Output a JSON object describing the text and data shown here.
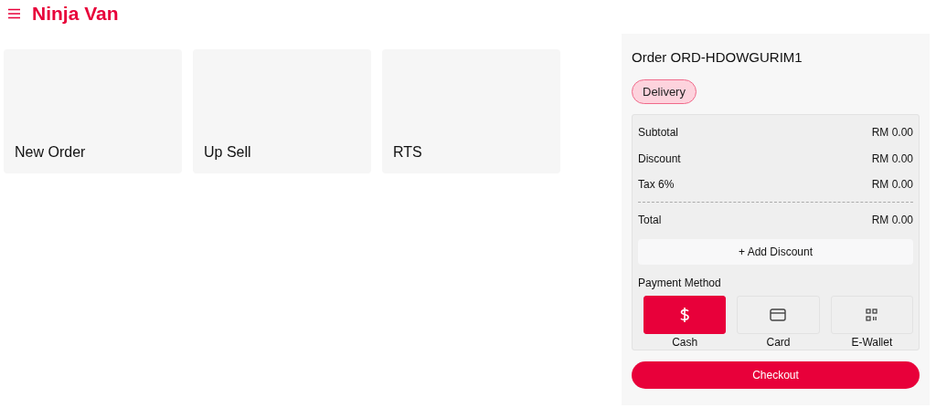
{
  "header": {
    "brand": "Ninja Van"
  },
  "tiles": [
    {
      "label": "New Order"
    },
    {
      "label": "Up Sell"
    },
    {
      "label": "RTS"
    }
  ],
  "order": {
    "title": "Order ORD-HDOWGURIM1",
    "order_type": "Delivery",
    "summary": [
      {
        "label": "Subtotal",
        "value": "RM 0.00"
      },
      {
        "label": "Discount",
        "value": "RM 0.00"
      },
      {
        "label": "Tax 6%",
        "value": "RM 0.00"
      }
    ],
    "total": {
      "label": "Total",
      "value": "RM 0.00"
    },
    "add_discount": "+ Add Discount",
    "payment_label": "Payment Method",
    "payment_methods": [
      {
        "kind": "cash",
        "label": "Cash",
        "selected": true
      },
      {
        "kind": "card",
        "label": "Card",
        "selected": false
      },
      {
        "kind": "ewallet",
        "label": "E-Wallet",
        "selected": false
      }
    ],
    "checkout": "Checkout"
  }
}
